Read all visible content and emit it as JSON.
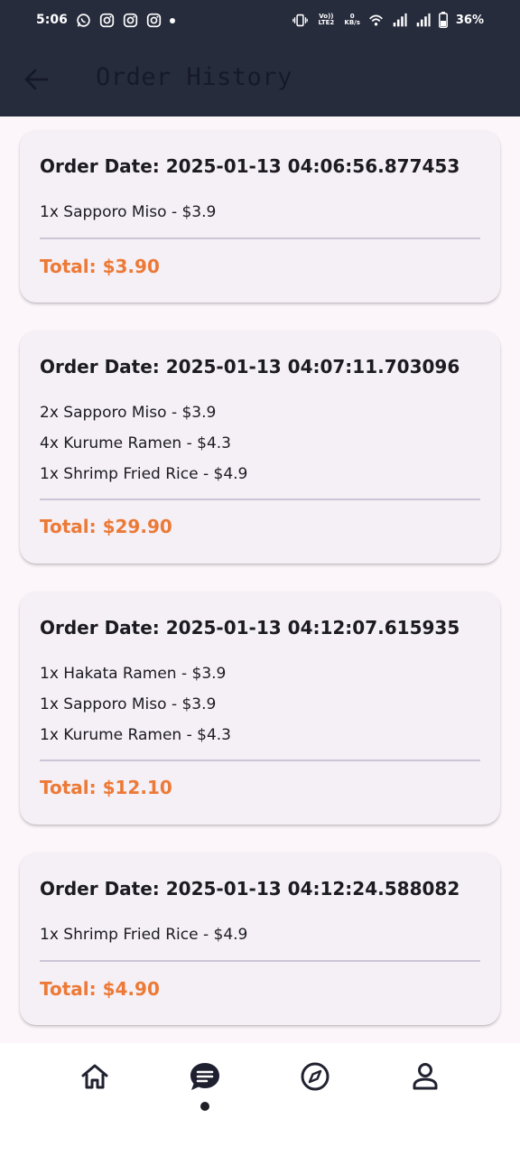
{
  "status_bar": {
    "time": "5:06",
    "network_top": "Vo)) LTE2",
    "speed_top": "0",
    "speed_bottom": "KB/s",
    "battery": "36%"
  },
  "app_bar": {
    "title": "Order History"
  },
  "orders": [
    {
      "date": "Order Date: 2025-01-13 04:06:56.877453",
      "items": [
        "1x Sapporo Miso - $3.9"
      ],
      "total": "Total: $3.90"
    },
    {
      "date": "Order Date: 2025-01-13 04:07:11.703096",
      "items": [
        "2x Sapporo Miso - $3.9",
        "4x Kurume Ramen - $4.3",
        "1x Shrimp Fried Rice - $4.9"
      ],
      "total": "Total: $29.90"
    },
    {
      "date": "Order Date: 2025-01-13 04:12:07.615935",
      "items": [
        "1x Hakata Ramen - $3.9",
        "1x Sapporo Miso - $3.9",
        "1x Kurume Ramen - $4.3"
      ],
      "total": "Total: $12.10"
    },
    {
      "date": "Order Date: 2025-01-13 04:12:24.588082",
      "items": [
        "1x Shrimp Fried Rice - $4.9"
      ],
      "total": "Total: $4.90"
    }
  ],
  "bottom_nav": {
    "items": [
      "home-icon",
      "chat-icon",
      "compass-icon",
      "person-icon"
    ],
    "selected": "chat-icon"
  },
  "colors": {
    "header_bg": "#272c3d",
    "page_bg": "#fcf6fb",
    "card_bg": "#f5eff6",
    "total_accent": "#ec7a36"
  }
}
